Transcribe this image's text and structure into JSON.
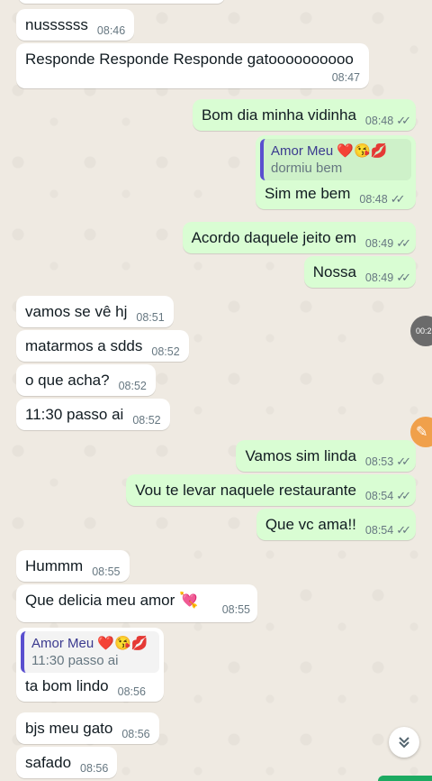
{
  "messages": [
    {
      "dir": "in",
      "text": "nussssss",
      "time": "08:46"
    },
    {
      "dir": "in",
      "text": "Responde  Responde  Responde  gatoooooooooo",
      "time": "08:47"
    },
    {
      "dir": "out",
      "text": "Bom dia minha vidinha",
      "time": "08:48"
    },
    {
      "dir": "out",
      "quote_author": "Amor Meu ❤️😘💋",
      "quote_text": "dormiu  bem",
      "text": "Sim me bem",
      "time": "08:48"
    },
    {
      "dir": "out",
      "text": "Acordo daquele jeito em",
      "time": "08:49"
    },
    {
      "dir": "out",
      "text": "Nossa",
      "time": "08:49"
    },
    {
      "dir": "in",
      "text": "vamos  se vê hj",
      "time": "08:51"
    },
    {
      "dir": "in",
      "text": "matarmos a sdds",
      "time": "08:52"
    },
    {
      "dir": "in",
      "text": "o que acha?",
      "time": "08:52"
    },
    {
      "dir": "in",
      "text": "11:30 passo  ai",
      "time": "08:52"
    },
    {
      "dir": "out",
      "text": "Vamos sim linda",
      "time": "08:53"
    },
    {
      "dir": "out",
      "text": "Vou te levar naquele restaurante",
      "time": "08:54"
    },
    {
      "dir": "out",
      "text": "Que vc ama!!",
      "time": "08:54"
    },
    {
      "dir": "in",
      "text": "Hummm",
      "time": "08:55"
    },
    {
      "dir": "in",
      "text": "Que delicia  meu amor 💘",
      "time": "08:55"
    },
    {
      "dir": "in",
      "quote_author": "Amor Meu ❤️😘💋",
      "quote_text": "11:30 passo  ai",
      "text": "ta bom lindo",
      "time": "08:56"
    },
    {
      "dir": "in",
      "text": "bjs  meu  gato",
      "time": "08:56"
    },
    {
      "dir": "in",
      "text": "safado",
      "time": "08:56"
    }
  ],
  "read_ticks": "✓✓",
  "video_timestamp": "00:2",
  "icons": {
    "scroll_down": "double-chevron-down-icon",
    "edit": "pencil-icon"
  },
  "colors": {
    "incoming": "#ffffff",
    "outgoing": "#d9fdd3",
    "background": "#efeae2",
    "quote_bar": "#5a4fcf"
  }
}
